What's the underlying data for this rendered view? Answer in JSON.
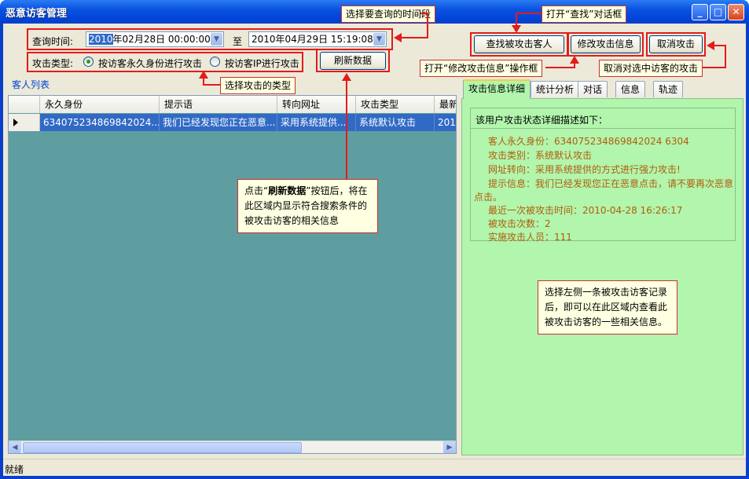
{
  "window": {
    "title": "恶意访客管理",
    "minimize": "_",
    "maximize": "□",
    "close": "✕"
  },
  "filters": {
    "time_label": "查询时间:",
    "from_year_selected": "2010",
    "from_rest": "年02月28日 00:00:00",
    "to_label": "至",
    "to_value": "2010年04月29日 15:19:08",
    "type_label": "攻击类型:",
    "radio_by_id": "按访客永久身份进行攻击",
    "radio_by_ip": "按访客IP进行攻击",
    "refresh_button": "刷新数据"
  },
  "toolbar": {
    "find_button": "查找被攻击客人",
    "edit_button": "修改攻击信息",
    "cancel_button": "取消攻击"
  },
  "guest_list": {
    "group_label": "客人列表",
    "columns": [
      "永久身份",
      "提示语",
      "转向网址",
      "攻击类型",
      "最新"
    ],
    "rows": [
      [
        "634075234869842024...",
        "我们已经发现您正在恶意...",
        "采用系统提供...",
        "系统默认攻击",
        "2010"
      ]
    ]
  },
  "tabs": [
    "攻击信息详细",
    "统计分析",
    "对话",
    "信息",
    "轨迹"
  ],
  "detail": {
    "heading": "该用户攻击状态详细描述如下：",
    "line1": "客人永久身份：634075234869842024 6304",
    "line2": "攻击类别：系统默认攻击",
    "line3": "网址转向：采用系统提供的方式进行强力攻击!",
    "line4a": "提示信息：我们已经发现您正在恶意点击，请不要再次恶意",
    "line4b": "点击。",
    "line5": "最近一次被攻击时间：2010-04-28 16:26:17",
    "line6": "被攻击次数：2",
    "line7": "实施攻击人员：111"
  },
  "callouts": {
    "time_range": "选择要查询的时间段",
    "open_find": "打开“查找”对话框",
    "open_edit": "打开“修改攻击信息”操作框",
    "cancel_selected": "取消对选中访客的攻击",
    "attack_type": "选择攻击的类型",
    "refresh_intro": "点击“",
    "refresh_bold": "刷新数据",
    "refresh_rest": "”按钮后，将在此区域内显示符合搜索条件的被攻击访客的相关信息",
    "detail_hint": "选择左侧一条被攻击访客记录后，即可以在此区域内查看此被攻击访客的一些相关信息。"
  },
  "status": {
    "text": "就绪"
  }
}
